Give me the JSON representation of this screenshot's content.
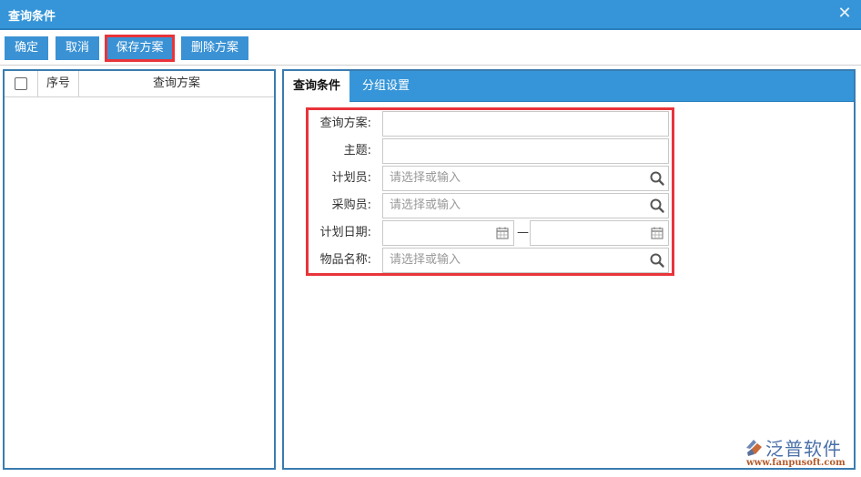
{
  "window": {
    "title": "查询条件",
    "close_icon": "close-icon"
  },
  "toolbar": {
    "buttons": [
      {
        "label": "确定",
        "highlighted": false
      },
      {
        "label": "取消",
        "highlighted": false
      },
      {
        "label": "保存方案",
        "highlighted": true
      },
      {
        "label": "删除方案",
        "highlighted": false
      }
    ]
  },
  "scheme_list": {
    "columns": [
      "",
      "序号",
      "查询方案"
    ],
    "rows": []
  },
  "tabs": [
    {
      "label": "查询条件",
      "active": true
    },
    {
      "label": "分组设置",
      "active": false
    }
  ],
  "form": {
    "fields": [
      {
        "label": "查询方案:",
        "value": "",
        "placeholder": "",
        "icon": null
      },
      {
        "label": "主题:",
        "value": "",
        "placeholder": "",
        "icon": null
      },
      {
        "label": "计划员:",
        "value": "",
        "placeholder": "请选择或输入",
        "icon": "search-icon"
      },
      {
        "label": "采购员:",
        "value": "",
        "placeholder": "请选择或输入",
        "icon": "search-icon"
      },
      {
        "label": "计划日期:",
        "from": "",
        "to": "",
        "separator": "—",
        "icon": "calendar-icon"
      },
      {
        "label": "物品名称:",
        "value": "",
        "placeholder": "请选择或输入",
        "icon": "search-icon"
      }
    ]
  },
  "watermark": {
    "name": "泛普软件",
    "url": "www.fanpusoft.com"
  },
  "colors": {
    "primary": "#3595d8",
    "highlight": "#e8343a",
    "panel_border": "#3a7cb0"
  }
}
